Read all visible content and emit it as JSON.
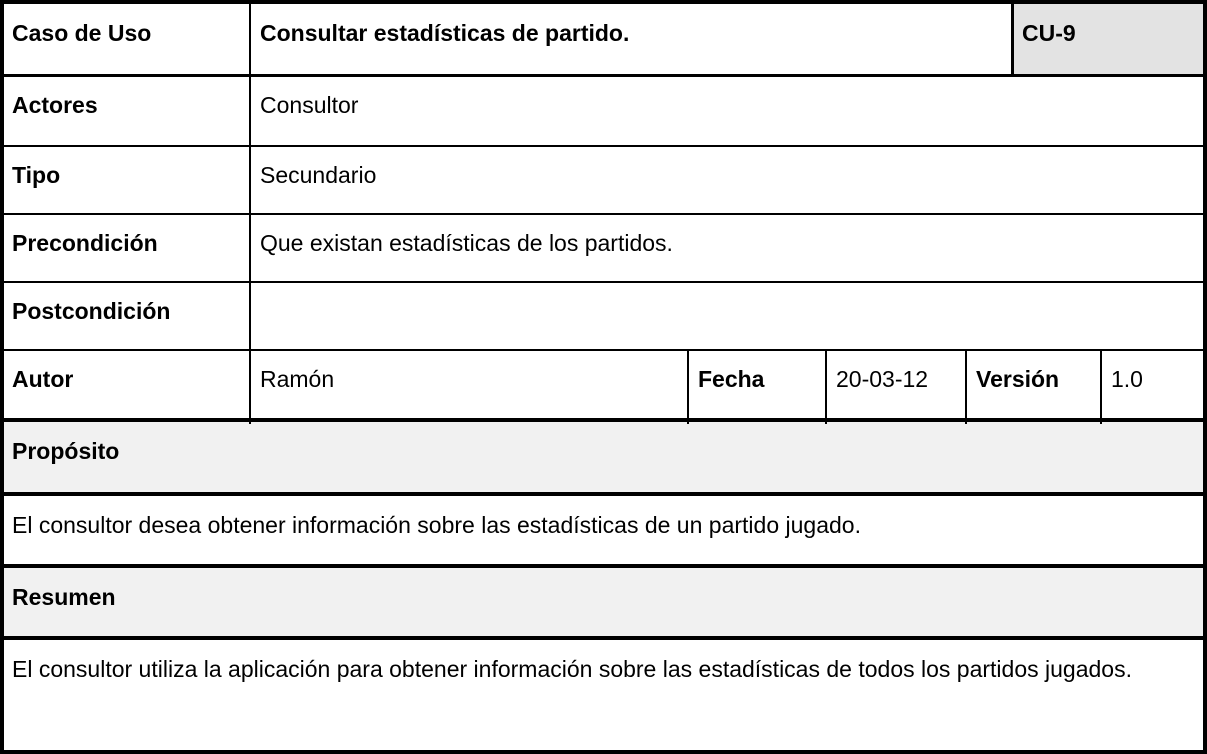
{
  "use_case": {
    "label": "Caso de Uso",
    "title": "Consultar estadísticas de partido.",
    "id": "CU-9",
    "actors_label": "Actores",
    "actors": "Consultor",
    "type_label": "Tipo",
    "type": "Secundario",
    "precondition_label": "Precondición",
    "precondition": "Que existan estadísticas de los partidos.",
    "postcondition_label": "Postcondición",
    "postcondition": "",
    "author_label": "Autor",
    "author": "Ramón",
    "date_label": "Fecha",
    "date": "20-03-12",
    "version_label": "Versión",
    "version": "1.0",
    "purpose_label": "Propósito",
    "purpose": "El consultor desea obtener información sobre las estadísticas de un partido jugado.",
    "summary_label": "Resumen",
    "summary": "El consultor utiliza la aplicación para obtener información sobre las estadísticas de todos los partidos jugados."
  }
}
